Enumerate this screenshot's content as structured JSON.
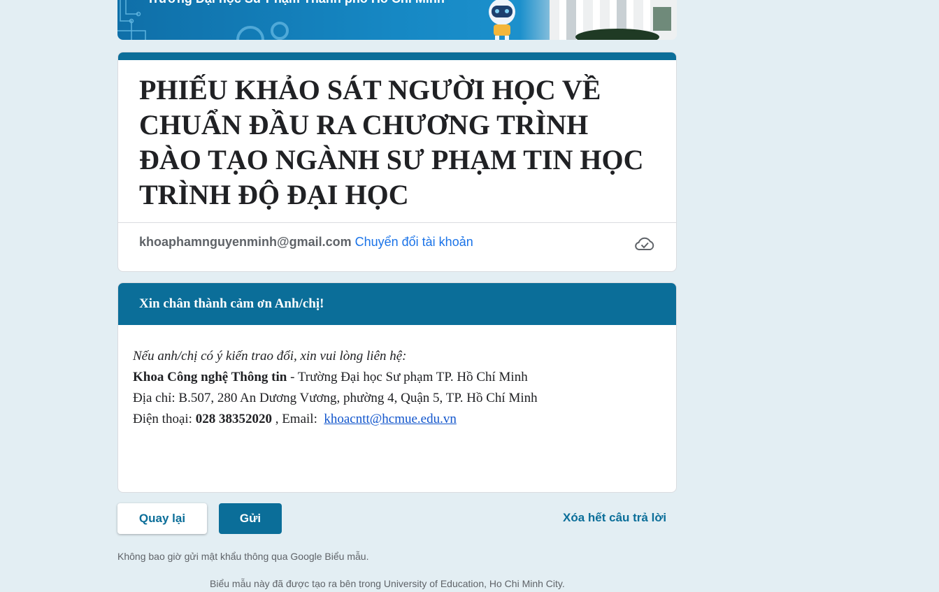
{
  "banner": {
    "title": "Trường Đại học Sư Phạm Thành phố Hồ Chí Minh"
  },
  "form": {
    "title": "PHIẾU KHẢO SÁT NGƯỜI HỌC VỀ CHUẨN ĐẦU RA CHƯƠNG TRÌNH ĐÀO TẠO NGÀNH SƯ PHẠM TIN HỌC TRÌNH ĐỘ ĐẠI HỌC",
    "account_email": "khoaphamnguyenminh@gmail.com",
    "switch_account": "Chuyển đổi tài khoản",
    "saved_icon": "cloud-check-icon"
  },
  "section": {
    "header": "Xin chân thành cảm ơn Anh/chị!",
    "contact_intro": "Nếu anh/chị có ý kiến trao đổi, xin vui lòng liên hệ:",
    "dept_name": "Khoa Công nghệ Thông tin",
    "dept_rest": " - Trường Đại học Sư phạm TP. Hồ Chí Minh",
    "address": "Địa chỉ: B.507, 280 An Dương Vương, phường 4, Quận 5, TP. Hồ Chí Minh",
    "phone_label": "Điện thoại: ",
    "phone": "028 38352020",
    "email_label": " , Email: ",
    "email": "khoacntt@hcmue.edu.vn"
  },
  "buttons": {
    "back": "Quay lại",
    "submit": "Gửi",
    "clear": "Xóa hết câu trả lời"
  },
  "footer": {
    "password_note": "Không bao giờ gửi mật khẩu thông qua Google Biểu mẫu.",
    "created_in": "Biểu mẫu này đã được tạo ra bên trong University of Education, Ho Chi Minh City."
  },
  "colors": {
    "accent": "#0b6e99",
    "link": "#1a73e8",
    "background": "#e3eef3"
  }
}
